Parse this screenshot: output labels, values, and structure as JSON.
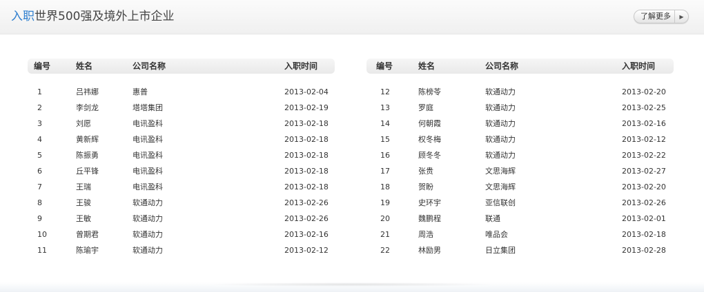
{
  "header": {
    "title_accent": "入职",
    "title_rest": "世界500强及境外上市企业",
    "more_label": "了解更多",
    "more_icon": "triangle-right-icon"
  },
  "columns": {
    "no": "编号",
    "name": "姓名",
    "company": "公司名称",
    "date": "入职时间"
  },
  "left_rows": [
    {
      "no": "1",
      "name": "吕祎娜",
      "company": "惠普",
      "date": "2013-02-04"
    },
    {
      "no": "2",
      "name": "李剑龙",
      "company": "塔塔集团",
      "date": "2013-02-19"
    },
    {
      "no": "3",
      "name": "刘愿",
      "company": "电讯盈科",
      "date": "2013-02-18"
    },
    {
      "no": "4",
      "name": "黄新辉",
      "company": "电讯盈科",
      "date": "2013-02-18"
    },
    {
      "no": "5",
      "name": "陈振勇",
      "company": "电讯盈科",
      "date": "2013-02-18"
    },
    {
      "no": "6",
      "name": "丘平锋",
      "company": "电讯盈科",
      "date": "2013-02-18"
    },
    {
      "no": "7",
      "name": "王瑞",
      "company": "电讯盈科",
      "date": "2013-02-18"
    },
    {
      "no": "8",
      "name": "王骏",
      "company": "软通动力",
      "date": "2013-02-26"
    },
    {
      "no": "9",
      "name": "王敏",
      "company": "软通动力",
      "date": "2013-02-26"
    },
    {
      "no": "10",
      "name": "曾期君",
      "company": "软通动力",
      "date": "2013-02-16"
    },
    {
      "no": "11",
      "name": "陈瑜宇",
      "company": "软通动力",
      "date": "2013-02-12"
    }
  ],
  "right_rows": [
    {
      "no": "12",
      "name": "陈榜苓",
      "company": "软通动力",
      "date": "2013-02-20"
    },
    {
      "no": "13",
      "name": "罗庭",
      "company": "软通动力",
      "date": "2013-02-25"
    },
    {
      "no": "14",
      "name": "何朝霞",
      "company": "软通动力",
      "date": "2013-02-16"
    },
    {
      "no": "15",
      "name": "权冬梅",
      "company": "软通动力",
      "date": "2013-02-12"
    },
    {
      "no": "16",
      "name": "顾冬冬",
      "company": "软通动力",
      "date": "2013-02-22"
    },
    {
      "no": "17",
      "name": "张贵",
      "company": "文思海辉",
      "date": "2013-02-27"
    },
    {
      "no": "18",
      "name": "贺盼",
      "company": "文思海辉",
      "date": "2013-02-20"
    },
    {
      "no": "19",
      "name": "史环宇",
      "company": "亚信联创",
      "date": "2013-02-26"
    },
    {
      "no": "20",
      "name": "魏鹏程",
      "company": "联通",
      "date": "2013-02-01"
    },
    {
      "no": "21",
      "name": "周浩",
      "company": "唯品会",
      "date": "2013-02-18"
    },
    {
      "no": "22",
      "name": "林励男",
      "company": "日立集团",
      "date": "2013-02-28"
    }
  ]
}
